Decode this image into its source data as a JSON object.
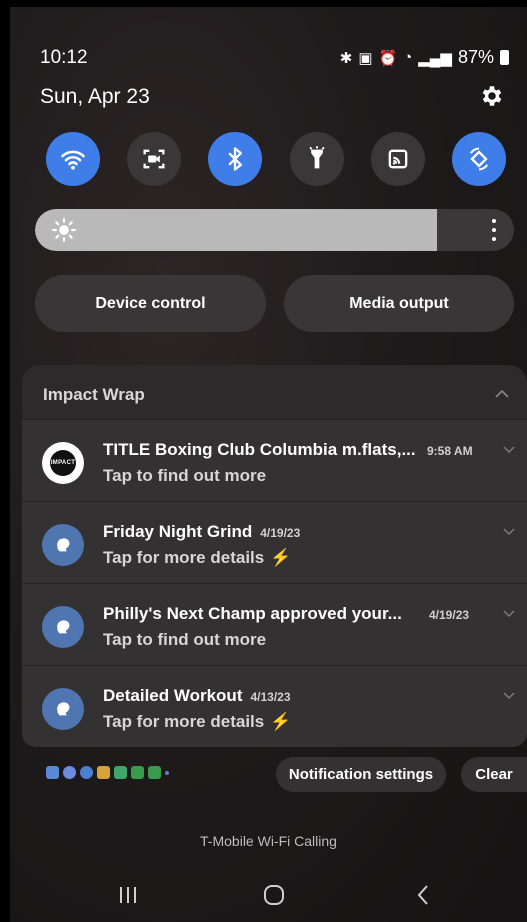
{
  "status": {
    "time": "10:12",
    "battery": "87%",
    "date": "Sun, Apr 23"
  },
  "quick_settings": [
    {
      "name": "wifi",
      "icon": "wifi-icon",
      "on": true
    },
    {
      "name": "screen-recorder",
      "icon": "screen-recorder-icon",
      "on": false
    },
    {
      "name": "bluetooth",
      "icon": "bluetooth-icon",
      "on": true
    },
    {
      "name": "flashlight",
      "icon": "flashlight-icon",
      "on": false
    },
    {
      "name": "cast",
      "icon": "cast-icon",
      "on": false
    },
    {
      "name": "auto-rotate",
      "icon": "auto-rotate-icon",
      "on": true
    }
  ],
  "brightness": {
    "level": 0.84
  },
  "controls": {
    "device_control": "Device control",
    "media_output": "Media output"
  },
  "notification_group": {
    "app_name": "Impact Wrap",
    "items": [
      {
        "title": "TITLE Boxing Club Columbia m.flats,...",
        "time": "9:58 AM",
        "subtitle": "Tap to find out more",
        "bolt": false,
        "avatar": "title-boxing-logo",
        "avatar_text": "IMPACT"
      },
      {
        "title": "Friday Night Grind",
        "time": "4/19/23",
        "subtitle": "Tap for more details",
        "bolt": true,
        "avatar": "boxing-glove-icon"
      },
      {
        "title": "Philly's Next Champ approved your...",
        "time": "4/19/23",
        "subtitle": "Tap to find out more",
        "bolt": false,
        "avatar": "boxing-glove-icon"
      },
      {
        "title": "Detailed Workout",
        "time": "4/13/23",
        "subtitle": "Tap for more details",
        "bolt": true,
        "avatar": "boxing-glove-icon"
      }
    ]
  },
  "footer": {
    "notification_settings": "Notification settings",
    "clear": "Clear",
    "carrier": "T-Mobile Wi-Fi Calling",
    "bolt_glyph": "⚡"
  },
  "colors": {
    "accent_on": "#3f7ee8",
    "toggle_off": "#3a3738",
    "panel": "#2d2a2b",
    "bolt": "#f4a528"
  }
}
